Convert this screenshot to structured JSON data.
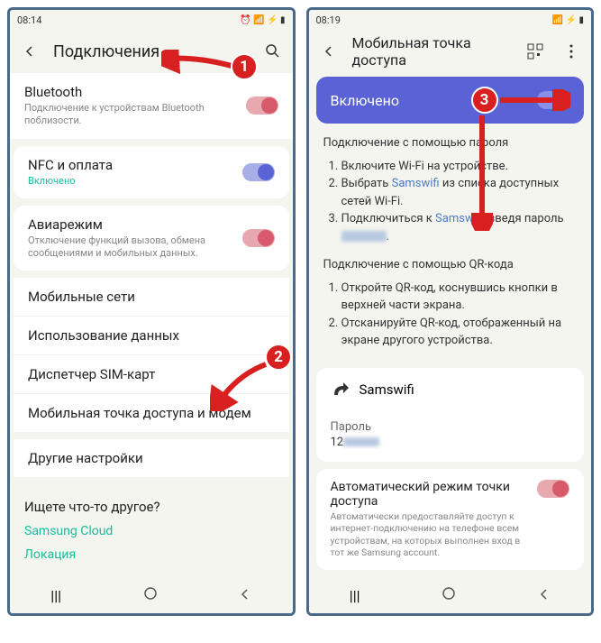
{
  "left": {
    "time": "08:14",
    "header_title": "Подключения",
    "bluetooth": {
      "title": "Bluetooth",
      "sub": "Подключение к устройствам Bluetooth поблизости."
    },
    "nfc": {
      "title": "NFC и оплата",
      "sub": "Включено"
    },
    "airmode": {
      "title": "Авиарежим",
      "sub": "Отключение функций вызова, обмена сообщениями и мобильных данных."
    },
    "mobile_networks": "Мобильные сети",
    "data_usage": "Использование данных",
    "sim_manager": "Диспетчер SIM-карт",
    "hotspot": "Мобильная точка доступа и модем",
    "other_settings": "Другие настройки",
    "looking_for": "Ищете что-то другое?",
    "link1": "Samsung Cloud",
    "link2": "Локация"
  },
  "right": {
    "time": "08:19",
    "header_title": "Мобильная точка доступа",
    "enabled": "Включено",
    "pass_section_title": "Подключение с помощью пароля",
    "step1a": "Включите Wi-Fi на устройстве.",
    "step2a": "Выбрать ",
    "ssid": "Samswifi",
    "step2b": " из списка доступных сетей Wi-Fi.",
    "step3a": "Подключиться к ",
    "step3b": ", введя пароль ",
    "qr_section_title": "Подключение с помощью QR-кода",
    "qr_step1": "Откройте QR-код, коснувшись кнопки в верхней части экрана.",
    "qr_step2": "Отсканируйте QR-код, отображенный на экране другого устройства.",
    "password_label": "Пароль",
    "password_value": "12",
    "auto_title": "Автоматический режим точки доступа",
    "auto_sub": "Автоматически предоставляйте доступ к интернет-подключению на телефоне всем устройствам, на которых выполнен вход в тот же Samsung account."
  },
  "badges": {
    "b1": "1",
    "b2": "2",
    "b3": "3"
  }
}
